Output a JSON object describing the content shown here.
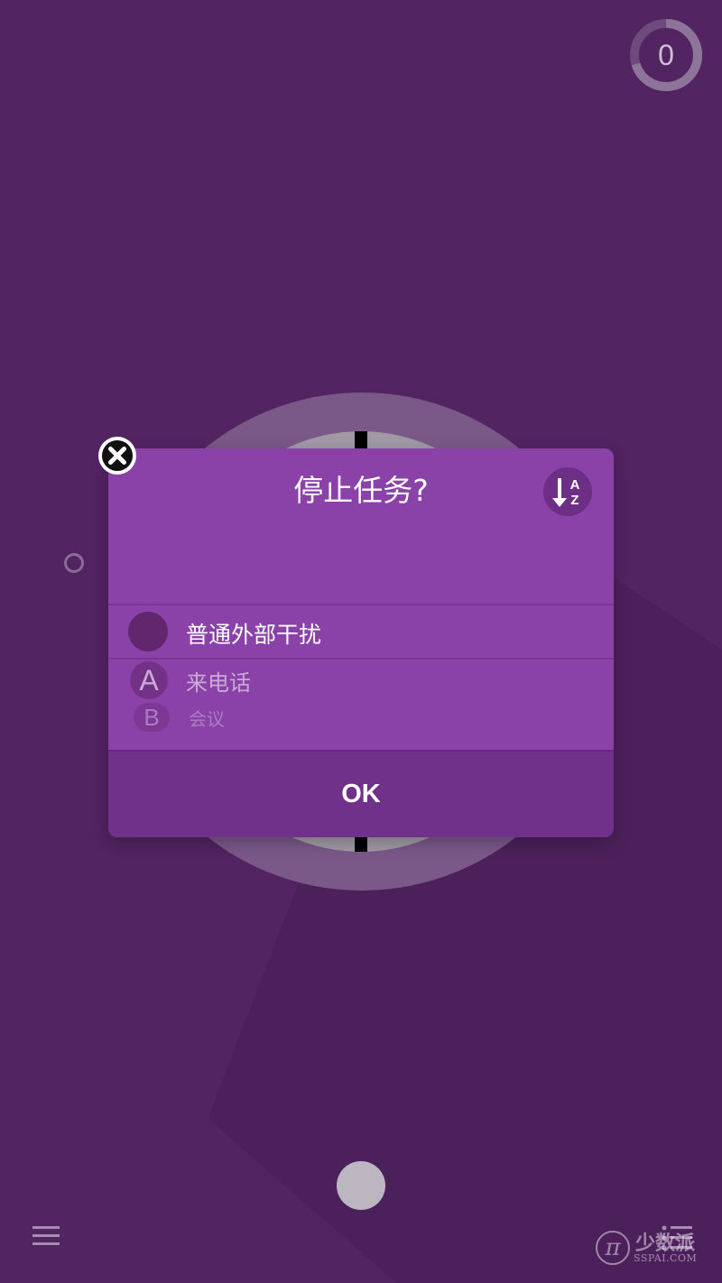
{
  "counter": {
    "value": "0",
    "progress": 0.72
  },
  "dialog": {
    "title": "停止任务?",
    "sort_icon": "sort-az-icon",
    "items": [
      {
        "badge": "",
        "label": "普通外部干扰"
      },
      {
        "badge": "A",
        "label": "来电话"
      },
      {
        "badge": "B",
        "label": "会议"
      }
    ],
    "ok_label": "OK"
  },
  "icons": {
    "close": "close-icon",
    "menu": "hamburger-menu-icon",
    "list": "task-list-icon"
  },
  "watermark": {
    "logo": "π",
    "name": "少数派",
    "site": "SSPAI.COM"
  },
  "colors": {
    "background": "#522462",
    "dialog": "#8a41a8",
    "dialog_footer": "#6f3189",
    "badge": "#62266f"
  }
}
